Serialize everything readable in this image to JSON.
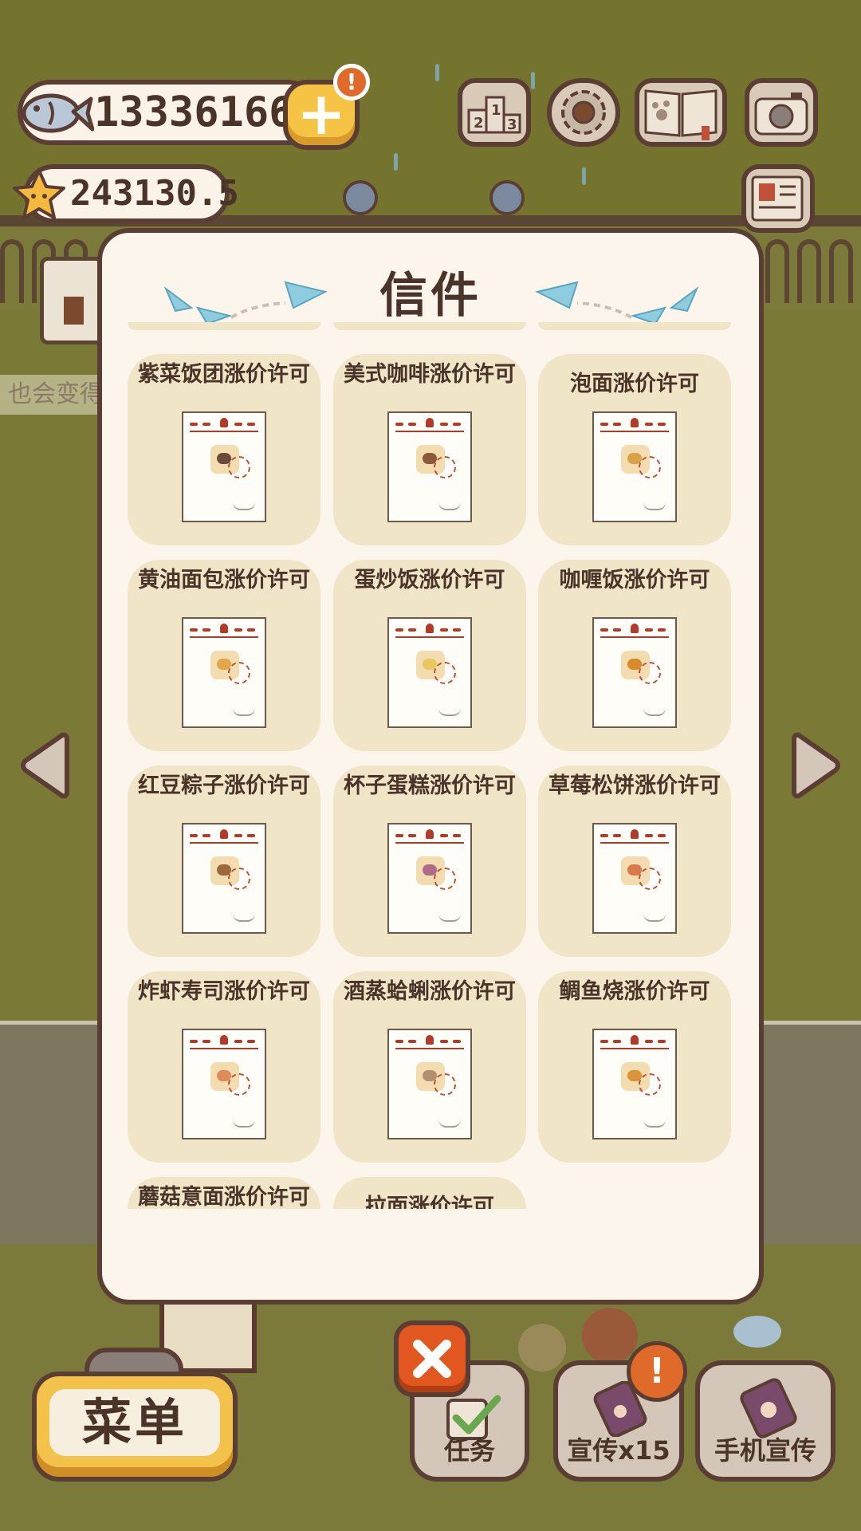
{
  "currency": {
    "fish": "13336166",
    "stars": "243130.5",
    "plus_label": "+",
    "alert_symbol": "!"
  },
  "background": {
    "ticker_text": "也会变得"
  },
  "hud_icons": [
    "ranking-icon",
    "gear-icon",
    "paw-book-icon",
    "camera-icon",
    "newspaper-icon"
  ],
  "modal": {
    "title": "信件",
    "letters": [
      {
        "title": "紫菜饭团涨价许可",
        "food_color": "#6a4a3a"
      },
      {
        "title": "美式咖啡涨价许可",
        "food_color": "#8a5a3a"
      },
      {
        "title": "泡面涨价许可",
        "food_color": "#d9a24a"
      },
      {
        "title": "黄油面包涨价许可",
        "food_color": "#e0a84a"
      },
      {
        "title": "蛋炒饭涨价许可",
        "food_color": "#e8c860"
      },
      {
        "title": "咖喱饭涨价许可",
        "food_color": "#d98a2a"
      },
      {
        "title": "红豆粽子涨价许可",
        "food_color": "#9a6a3a"
      },
      {
        "title": "杯子蛋糕涨价许可",
        "food_color": "#b06a8a"
      },
      {
        "title": "草莓松饼涨价许可",
        "food_color": "#d97a4a"
      },
      {
        "title": "炸虾寿司涨价许可",
        "food_color": "#e08a5a"
      },
      {
        "title": "酒蒸蛤蜊涨价许可",
        "food_color": "#b09070"
      },
      {
        "title": "鲷鱼烧涨价许可",
        "food_color": "#d9943a"
      },
      {
        "title": "蘑菇意面涨价许可",
        "food_color": "#c8a070"
      },
      {
        "title": "拉面涨价许可",
        "food_color": "#d9b070"
      }
    ]
  },
  "bottom_bar": {
    "menu": "菜单",
    "tasks": "任务",
    "promote": "宣传x15",
    "phone_promote": "手机宣传",
    "close_symbol": "×"
  },
  "colors": {
    "accent_yellow": "#f2c24a",
    "close_orange": "#e2571f",
    "outline_brown": "#5a3e34",
    "card_beige": "#f1e5c7",
    "plane_blue": "#8ecde0"
  }
}
